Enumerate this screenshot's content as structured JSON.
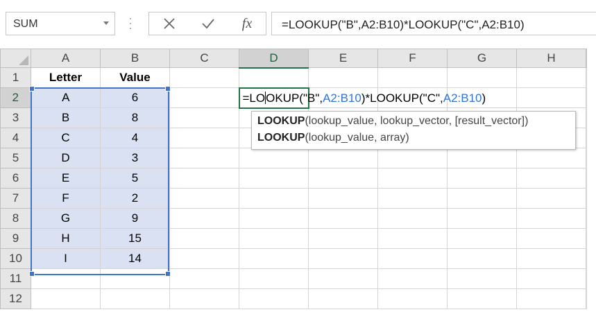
{
  "name_box": {
    "value": "SUM"
  },
  "formula_bar": {
    "cancel_icon": "x-icon",
    "enter_icon": "check-icon",
    "fx_label": "fx",
    "formula": "=LOOKUP(\"B\",A2:B10)*LOOKUP(\"C\",A2:B10)"
  },
  "columns": [
    "A",
    "B",
    "C",
    "D",
    "E",
    "F",
    "G",
    "H"
  ],
  "active_column": "D",
  "active_row": "2",
  "rows": [
    {
      "num": "1",
      "a": "Letter",
      "b": "Value"
    },
    {
      "num": "2",
      "a": "A",
      "b": "6"
    },
    {
      "num": "3",
      "a": "B",
      "b": "8"
    },
    {
      "num": "4",
      "a": "C",
      "b": "4"
    },
    {
      "num": "5",
      "a": "D",
      "b": "3"
    },
    {
      "num": "6",
      "a": "E",
      "b": "5"
    },
    {
      "num": "7",
      "a": "F",
      "b": "2"
    },
    {
      "num": "8",
      "a": "G",
      "b": "9"
    },
    {
      "num": "9",
      "a": "H",
      "b": "15"
    },
    {
      "num": "10",
      "a": "I",
      "b": "14"
    },
    {
      "num": "11",
      "a": "",
      "b": ""
    },
    {
      "num": "12",
      "a": "",
      "b": ""
    }
  ],
  "edit_cell": {
    "prefix": "=LO",
    "after_caret": "OKUP(\"B\",",
    "ref1": "A2:B10",
    "middle": ")*LOOKUP(\"C\",",
    "ref2": "A2:B10",
    "suffix": ")"
  },
  "tooltip": {
    "line1_fn": "LOOKUP",
    "line1_args": "(lookup_value, lookup_vector, [result_vector])",
    "line2_fn": "LOOKUP",
    "line2_args": "(lookup_value, array)"
  },
  "colors": {
    "accent_green": "#217346",
    "selection_blue": "#4472c4",
    "reference_blue": "#2e74d6",
    "selection_fill": "#d9e1f2"
  }
}
